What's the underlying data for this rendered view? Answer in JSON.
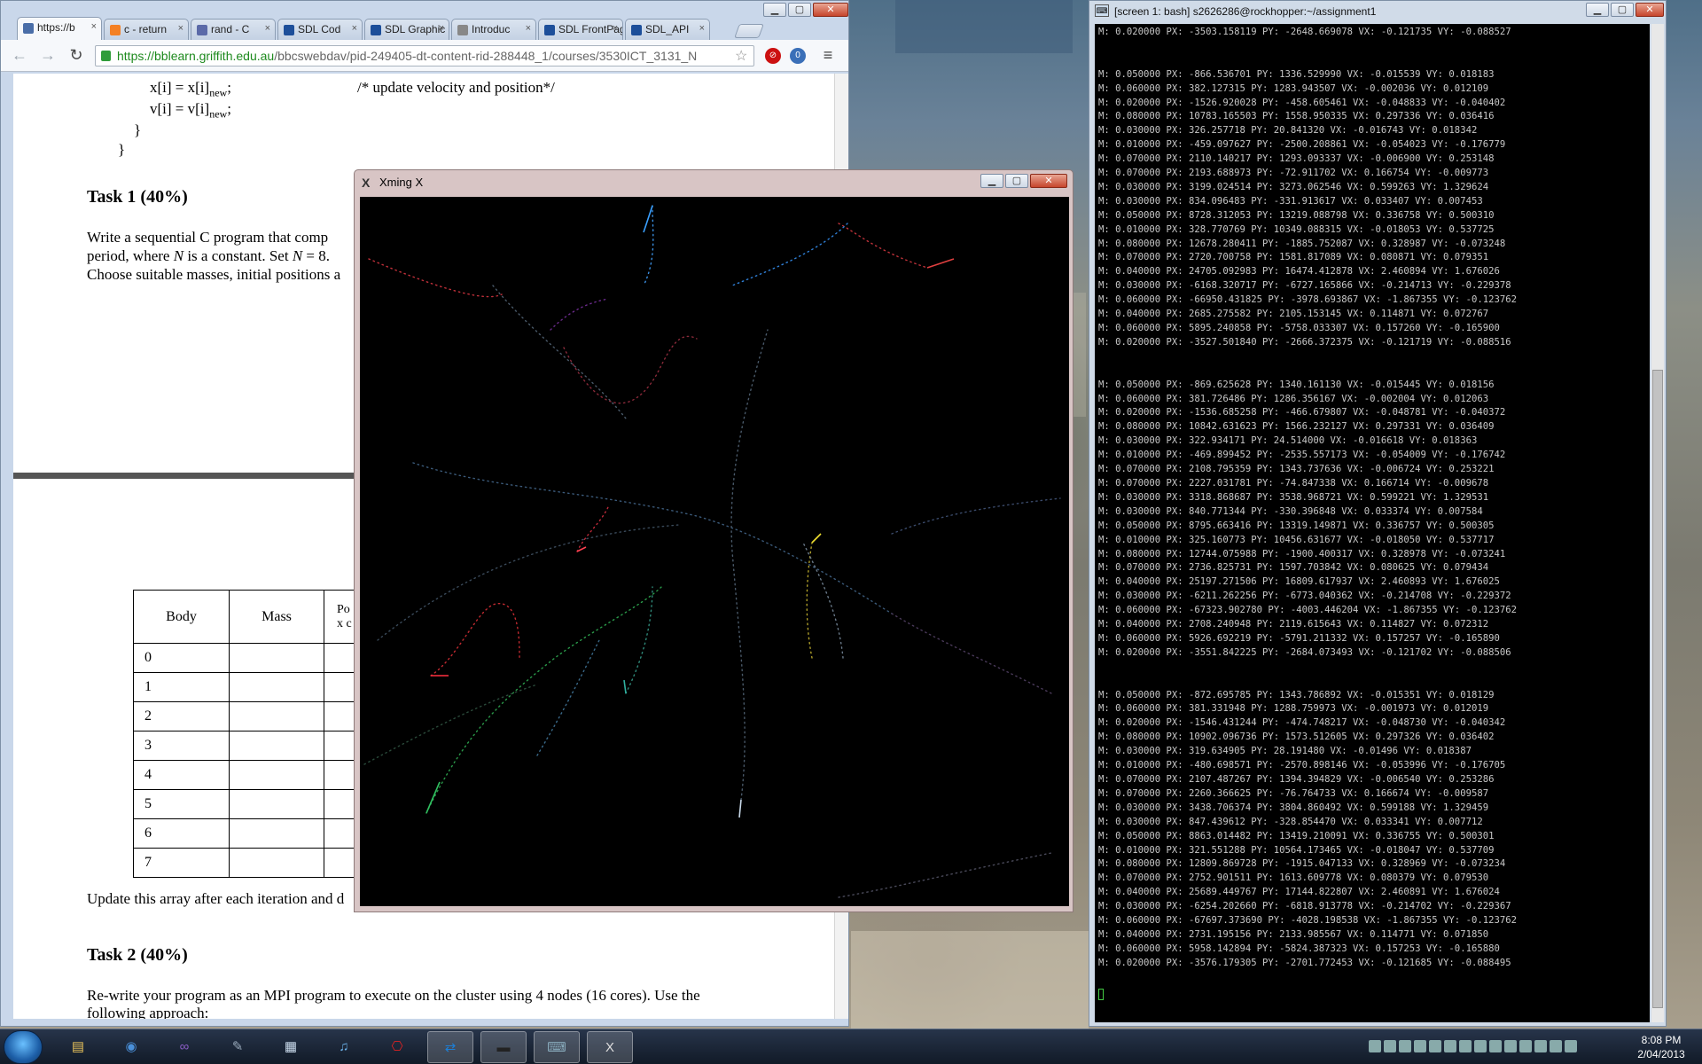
{
  "chrome": {
    "tabs": [
      {
        "label": "https://b",
        "icon": "page-icon",
        "color": "#4a6ea8"
      },
      {
        "label": "c - return",
        "icon": "stackoverflow-icon",
        "color": "#f48024"
      },
      {
        "label": "rand - C",
        "icon": "cplusplus-icon",
        "color": "#5b6aa8"
      },
      {
        "label": "SDL Cod",
        "icon": "sdl-icon",
        "color": "#1d4f9a"
      },
      {
        "label": "SDL Graphic",
        "icon": "sdl-icon",
        "color": "#1d4f9a"
      },
      {
        "label": "Introduc",
        "icon": "page-icon",
        "color": "#888"
      },
      {
        "label": "SDL FrontPag",
        "icon": "sdl-icon",
        "color": "#1d4f9a"
      },
      {
        "label": "SDL_API",
        "icon": "sdl-icon",
        "color": "#1d4f9a"
      }
    ],
    "url_green": "https://bblearn.griffith.edu.au",
    "url_rest": "/bbcswebdav/pid-249405-dt-content-rid-288448_1/courses/3530ICT_3131_N",
    "ext_badge": "0"
  },
  "document": {
    "code1_a": "x[i] = x[i]",
    "code1_sub": "new",
    "code1_semi": ";",
    "code1_comment": "/* update velocity and position*/",
    "code2_a": "v[i] = v[i]",
    "code2_sub": "new",
    "code2_semi": ";",
    "brace1": "}",
    "brace2": "}",
    "task1_heading": "Task 1 (40%)",
    "task1_line1": "Write a sequential C program that comp",
    "task1_line2_a": "period, where ",
    "task1_line2_n": "N",
    "task1_line2_b": " is a constant.  Set ",
    "task1_line2_n2": "N",
    "task1_line2_c": " = 8.",
    "task1_line3": "Choose suitable masses, initial positions a",
    "table_header": [
      "Body",
      "Mass",
      "Po\nx c"
    ],
    "table_rows": [
      "0",
      "1",
      "2",
      "3",
      "4",
      "5",
      "6",
      "7"
    ],
    "update_line": "Update this array after each iteration and d",
    "task2_heading": "Task 2 (40%)",
    "task2_line1": "Re-write your program as an MPI program to execute on the cluster using 4 nodes (16 cores). Use the",
    "task2_line2": "following approach:"
  },
  "xming": {
    "title": "Xming X"
  },
  "terminal": {
    "title": "[screen 1: bash] s2626286@rockhopper:~/assignment1",
    "top_line": "M: 0.020000 PX: -3503.158119 PY: -2648.669078 VX: -0.121735 VY: -0.088527",
    "block1": [
      "M: 0.050000 PX: -866.536701 PY: 1336.529990 VX: -0.015539 VY: 0.018183",
      "M: 0.060000 PX: 382.127315 PY: 1283.943507 VX: -0.002036 VY: 0.012109",
      "M: 0.020000 PX: -1526.920028 PY: -458.605461 VX: -0.048833 VY: -0.040402",
      "M: 0.080000 PX: 10783.165503 PY: 1558.950335 VX: 0.297336 VY: 0.036416",
      "M: 0.030000 PX: 326.257718 PY: 20.841320 VX: -0.016743 VY: 0.018342",
      "M: 0.010000 PX: -459.097627 PY: -2500.208861 VX: -0.054023 VY: -0.176779",
      "M: 0.070000 PX: 2110.140217 PY: 1293.093337 VX: -0.006900 VY: 0.253148",
      "M: 0.070000 PX: 2193.688973 PY: -72.911702 VX: 0.166754 VY: -0.009773",
      "M: 0.030000 PX: 3199.024514 PY: 3273.062546 VX: 0.599263 VY: 1.329624",
      "M: 0.030000 PX: 834.096483 PY: -331.913617 VX: 0.033407 VY: 0.007453",
      "M: 0.050000 PX: 8728.312053 PY: 13219.088798 VX: 0.336758 VY: 0.500310",
      "M: 0.010000 PX: 328.770769 PY: 10349.088315 VX: -0.018053 VY: 0.537725",
      "M: 0.080000 PX: 12678.280411 PY: -1885.752087 VX: 0.328987 VY: -0.073248",
      "M: 0.070000 PX: 2720.700758 PY: 1581.817089 VX: 0.080871 VY: 0.079351",
      "M: 0.040000 PX: 24705.092983 PY: 16474.412878 VX: 2.460894 VY: 1.676026",
      "M: 0.030000 PX: -6168.320717 PY: -6727.165866 VX: -0.214713 VY: -0.229378",
      "M: 0.060000 PX: -66950.431825 PY: -3978.693867 VX: -1.867355 VY: -0.123762",
      "M: 0.040000 PX: 2685.275582 PY: 2105.153145 VX: 0.114871 VY: 0.072767",
      "M: 0.060000 PX: 5895.240858 PY: -5758.033307 VX: 0.157260 VY: -0.165900",
      "M: 0.020000 PX: -3527.501840 PY: -2666.372375 VX: -0.121719 VY: -0.088516"
    ],
    "block2": [
      "M: 0.050000 PX: -869.625628 PY: 1340.161130 VX: -0.015445 VY: 0.018156",
      "M: 0.060000 PX: 381.726486 PY: 1286.356167 VX: -0.002004 VY: 0.012063",
      "M: 0.020000 PX: -1536.685258 PY: -466.679807 VX: -0.048781 VY: -0.040372",
      "M: 0.080000 PX: 10842.631623 PY: 1566.232127 VX: 0.297331 VY: 0.036409",
      "M: 0.030000 PX: 322.934171 PY: 24.514000 VX: -0.016618 VY: 0.018363",
      "M: 0.010000 PX: -469.899452 PY: -2535.557173 VX: -0.054009 VY: -0.176742",
      "M: 0.070000 PX: 2108.795359 PY: 1343.737636 VX: -0.006724 VY: 0.253221",
      "M: 0.070000 PX: 2227.031781 PY: -74.847338 VX: 0.166714 VY: -0.009678",
      "M: 0.030000 PX: 3318.868687 PY: 3538.968721 VX: 0.599221 VY: 1.329531",
      "M: 0.030000 PX: 840.771344 PY: -330.396848 VX: 0.033374 VY: 0.007584",
      "M: 0.050000 PX: 8795.663416 PY: 13319.149871 VX: 0.336757 VY: 0.500305",
      "M: 0.010000 PX: 325.160773 PY: 10456.631677 VX: -0.018050 VY: 0.537717",
      "M: 0.080000 PX: 12744.075988 PY: -1900.400317 VX: 0.328978 VY: -0.073241",
      "M: 0.070000 PX: 2736.825731 PY: 1597.703842 VX: 0.080625 VY: 0.079434",
      "M: 0.040000 PX: 25197.271506 PY: 16809.617937 VX: 2.460893 VY: 1.676025",
      "M: 0.030000 PX: -6211.262256 PY: -6773.040362 VX: -0.214708 VY: -0.229372",
      "M: 0.060000 PX: -67323.902780 PY: -4003.446204 VX: -1.867355 VY: -0.123762",
      "M: 0.040000 PX: 2708.240948 PY: 2119.615643 VX: 0.114827 VY: 0.072312",
      "M: 0.060000 PX: 5926.692219 PY: -5791.211332 VX: 0.157257 VY: -0.165890",
      "M: 0.020000 PX: -3551.842225 PY: -2684.073493 VX: -0.121702 VY: -0.088506"
    ],
    "block3": [
      "M: 0.050000 PX: -872.695785 PY: 1343.786892 VX: -0.015351 VY: 0.018129",
      "M: 0.060000 PX: 381.331948 PY: 1288.759973 VX: -0.001973 VY: 0.012019",
      "M: 0.020000 PX: -1546.431244 PY: -474.748217 VX: -0.048730 VY: -0.040342",
      "M: 0.080000 PX: 10902.096736 PY: 1573.512605 VX: 0.297326 VY: 0.036402",
      "M: 0.030000 PX: 319.634905 PY: 28.191480 VX: -0.01496 VY: 0.018387",
      "M: 0.010000 PX: -480.698571 PY: -2570.898146 VX: -0.053996 VY: -0.176705",
      "M: 0.070000 PX: 2107.487267 PY: 1394.394829 VX: -0.006540 VY: 0.253286",
      "M: 0.070000 PX: 2260.366625 PY: -76.764733 VX: 0.166674 VY: -0.009587",
      "M: 0.030000 PX: 3438.706374 PY: 3804.860492 VX: 0.599188 VY: 1.329459",
      "M: 0.030000 PX: 847.439612 PY: -328.854470 VX: 0.033341 VY: 0.007712",
      "M: 0.050000 PX: 8863.014482 PY: 13419.210091 VX: 0.336755 VY: 0.500301",
      "M: 0.010000 PX: 321.551288 PY: 10564.173465 VX: -0.018047 VY: 0.537709",
      "M: 0.080000 PX: 12809.869728 PY: -1915.047133 VX: 0.328969 VY: -0.073234",
      "M: 0.070000 PX: 2752.901511 PY: 1613.609778 VX: 0.080379 VY: 0.079530",
      "M: 0.040000 PX: 25689.449767 PY: 17144.822807 VX: 2.460891 VY: 1.676024",
      "M: 0.030000 PX: -6254.202660 PY: -6818.913778 VX: -0.214702 VY: -0.229367",
      "M: 0.060000 PX: -67697.373690 PY: -4028.198538 VX: -1.867355 VY: -0.123762",
      "M: 0.040000 PX: 2731.195156 PY: 2133.985567 VX: 0.114771 VY: 0.071850",
      "M: 0.060000 PX: 5958.142894 PY: -5824.387323 VX: 0.157253 VY: -0.165880",
      "M: 0.020000 PX: -3576.179305 PY: -2701.772453 VX: -0.121685 VY: -0.088495"
    ]
  },
  "taskbar": {
    "apps": [
      {
        "name": "explorer-icon",
        "glyph": "▤",
        "color": "#e8c25a"
      },
      {
        "name": "chrome-icon",
        "glyph": "◉",
        "color": "#4a90d9"
      },
      {
        "name": "visual-studio-icon",
        "glyph": "∞",
        "color": "#8a5cc4"
      },
      {
        "name": "notepad-icon",
        "glyph": "✎",
        "color": "#9ab"
      },
      {
        "name": "calculator-icon",
        "glyph": "▦",
        "color": "#cde"
      },
      {
        "name": "itunes-icon",
        "glyph": "♫",
        "color": "#6ab0e8"
      },
      {
        "name": "acrobat-icon",
        "glyph": "⎔",
        "color": "#d22"
      },
      {
        "name": "teamviewer-icon",
        "glyph": "⇄",
        "color": "#1c7fd6"
      },
      {
        "name": "cmd-icon",
        "glyph": "▬",
        "color": "#222"
      },
      {
        "name": "putty-icon",
        "glyph": "⌨",
        "color": "#8ab"
      },
      {
        "name": "xming-icon",
        "glyph": "X",
        "color": "#ddd"
      }
    ],
    "time": "8:08 PM",
    "date": "2/04/2013"
  }
}
